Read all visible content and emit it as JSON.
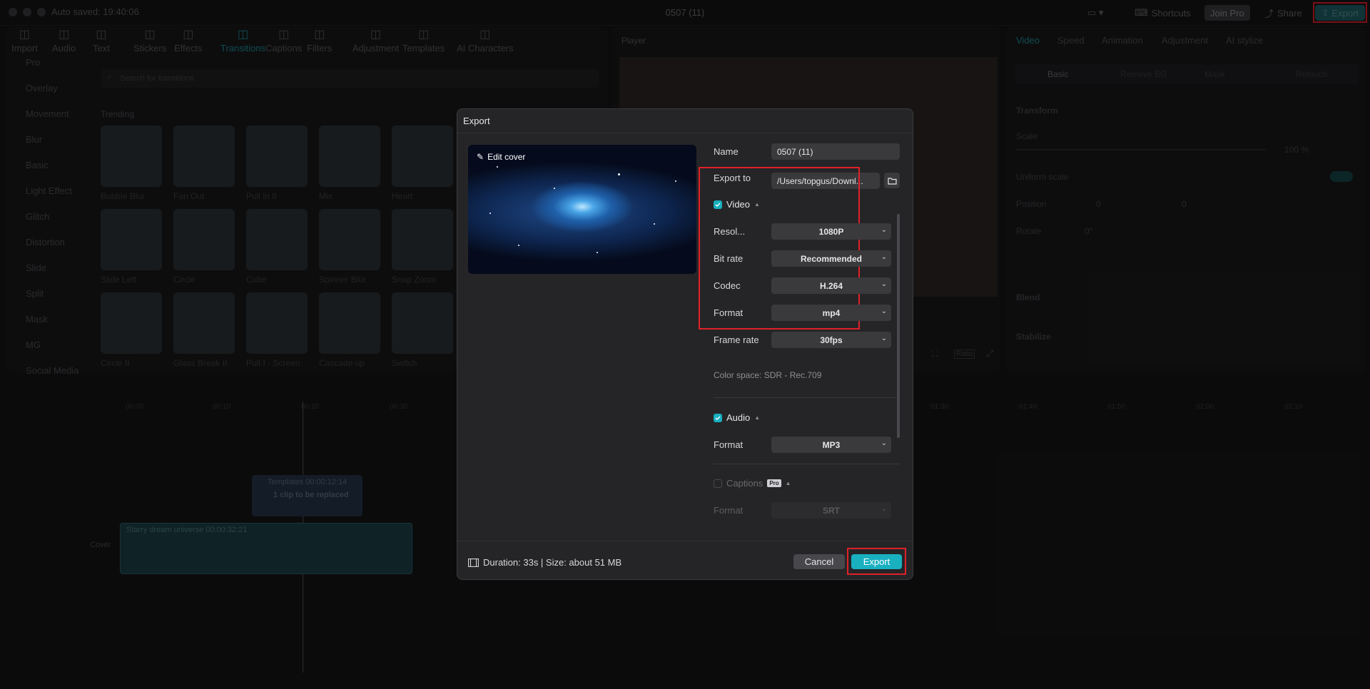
{
  "titlebar": {
    "autosave": "Auto saved: 19:40:06",
    "window_title": "0507 (11)",
    "shortcuts": "Shortcuts",
    "join_pro": "Join Pro",
    "share": "Share",
    "export": "Export"
  },
  "toolbar": [
    {
      "label": "Import",
      "icon": "import-icon"
    },
    {
      "label": "Audio",
      "icon": "audio-icon"
    },
    {
      "label": "Text",
      "icon": "text-icon"
    },
    {
      "label": "Stickers",
      "icon": "sticker-icon"
    },
    {
      "label": "Effects",
      "icon": "effects-icon"
    },
    {
      "label": "Transitions",
      "icon": "transitions-icon",
      "active": true
    },
    {
      "label": "Captions",
      "icon": "captions-icon"
    },
    {
      "label": "Filters",
      "icon": "filters-icon"
    },
    {
      "label": "Adjustment",
      "icon": "adjustment-icon"
    },
    {
      "label": "Templates",
      "icon": "templates-icon"
    },
    {
      "label": "AI Characters",
      "icon": "ai-characters-icon"
    }
  ],
  "left_nav": [
    "Pro",
    "Overlay",
    "Movement",
    "Blur",
    "Basic",
    "Light Effect",
    "Glitch",
    "Distortion",
    "Slide",
    "Split",
    "Mask",
    "MG",
    "Social Media"
  ],
  "library": {
    "search_placeholder": "Search for transitions",
    "trending": "Trending",
    "items": [
      "Bubble Blur",
      "Fan Out",
      "Pull in II",
      "Mix",
      "Heart",
      "Slide Left",
      "Circle",
      "Cube",
      "Spinner Blur",
      "Snap Zoom",
      "Circle II",
      "Glass Break II",
      "Pull I - Screen",
      "Cascade up",
      "Switch"
    ]
  },
  "player": {
    "label": "Player",
    "ratio": "Ratio"
  },
  "right_panel": {
    "tabs": [
      "Video",
      "Speed",
      "Animation",
      "Adjustment",
      "AI stylize"
    ],
    "subtabs": [
      "Basic",
      "Remove BG",
      "Mask",
      "Retouch"
    ],
    "transform": "Transform",
    "scale": "Scale",
    "scale_value": "100 %",
    "uniform_scale": "Uniform scale",
    "position": "Position",
    "pos_x": "0",
    "pos_y": "0",
    "rotate": "Rotate",
    "rotate_value": "0°",
    "blend": "Blend",
    "stabilize": "Stabilize"
  },
  "timeline": {
    "ruler": [
      "00:00",
      "00:10",
      "00:20",
      "00:30",
      "01:30",
      "01:40",
      "01:50",
      "02:00",
      "02:10"
    ],
    "template_clip": "Templates  00:00:12:14",
    "template_sub": "1 clip to be replaced",
    "main_clip": "Starry dream universe  00:00:32:21",
    "cover": "Cover"
  },
  "dialog": {
    "title": "Export",
    "edit_cover": "Edit cover",
    "name_label": "Name",
    "name_value": "0507 (11)",
    "export_to_label": "Export to",
    "export_to_value": "/Users/topgus/Downl...",
    "video_label": "Video",
    "resolution_label": "Resol...",
    "resolution_value": "1080P",
    "bitrate_label": "Bit rate",
    "bitrate_value": "Recommended",
    "codec_label": "Codec",
    "codec_value": "H.264",
    "format_label": "Format",
    "format_value": "mp4",
    "framerate_label": "Frame rate",
    "framerate_value": "30fps",
    "color_space": "Color space: SDR - Rec.709",
    "audio_label": "Audio",
    "audio_format_label": "Format",
    "audio_format_value": "MP3",
    "captions_label": "Captions",
    "captions_badge": "Pro",
    "captions_format_label": "Format",
    "captions_format_value": "SRT",
    "footer_info": "Duration: 33s | Size: about 51 MB",
    "cancel": "Cancel",
    "export": "Export"
  },
  "colors": {
    "accent": "#19b0c0",
    "highlight_box": "#e0202a",
    "dialog_bg": "#252527"
  }
}
